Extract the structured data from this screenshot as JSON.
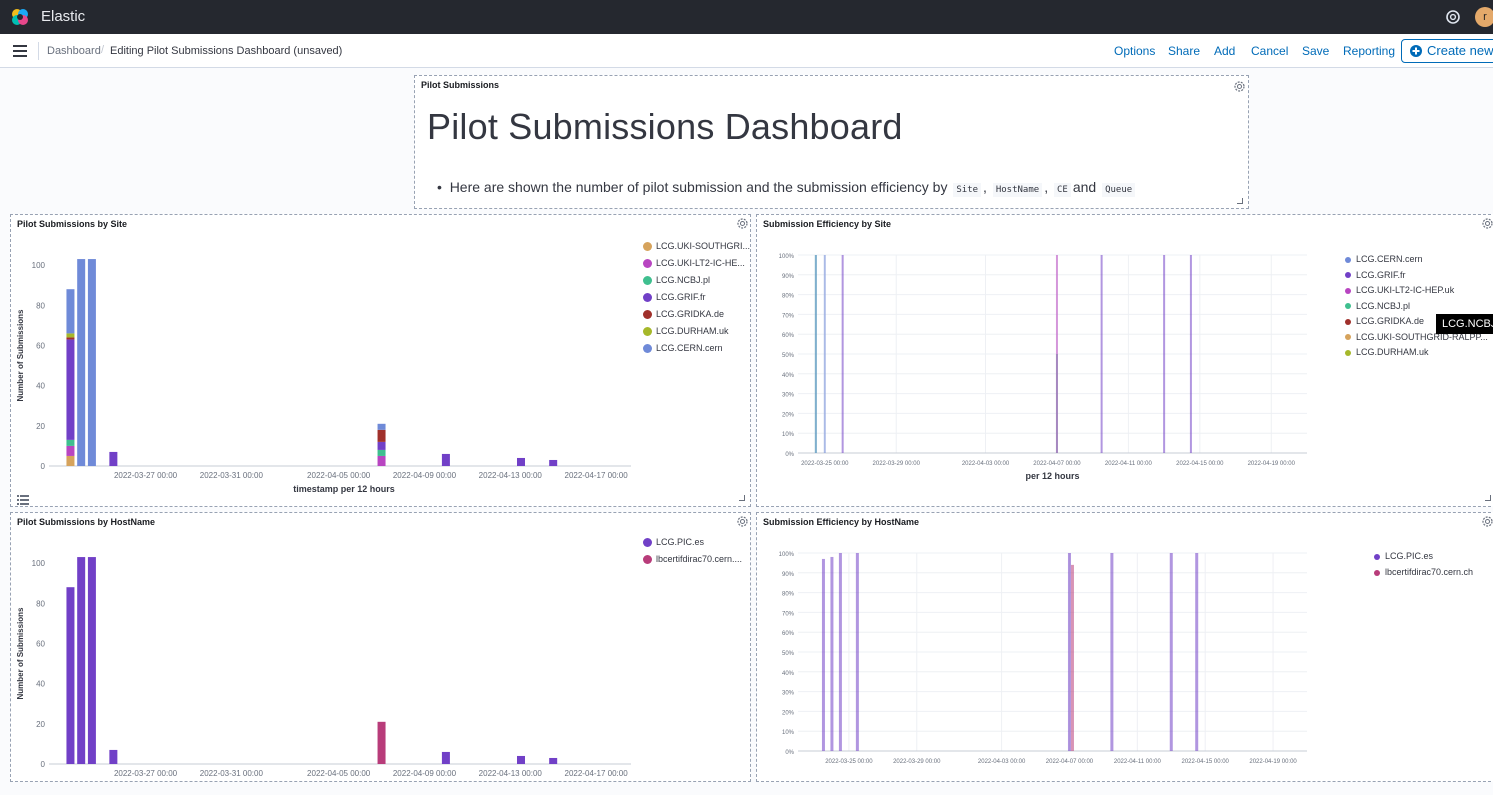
{
  "app": {
    "title": "Elastic",
    "avatar_initial": "r"
  },
  "breadcrumb": {
    "root": "Dashboard",
    "separator": "/",
    "current": "Editing Pilot Submissions Dashboard (unsaved)"
  },
  "top_nav": {
    "links": [
      "Options",
      "Share",
      "Add",
      "Cancel",
      "Save",
      "Reporting"
    ],
    "create_new_label": "Create new"
  },
  "markdown_panel": {
    "title": "Pilot Submissions",
    "heading": "Pilot Submissions Dashboard",
    "bullet_text": "Here are shown the number of pilot submission and the submission efficiency by",
    "codes": [
      "Site",
      "HostName",
      "CE",
      "Queue"
    ],
    "separators": [
      ",",
      ",",
      "and"
    ]
  },
  "panels": {
    "site_bar": {
      "title": "Pilot Submissions by Site",
      "legend": [
        {
          "label": "LCG.UKI-SOUTHGRI...",
          "color": "#d6a35c"
        },
        {
          "label": "LCG.UKI-LT2-IC-HE...",
          "color": "#b845c1"
        },
        {
          "label": "LCG.NCBJ.pl",
          "color": "#3fbf8f"
        },
        {
          "label": "LCG.GRIF.fr",
          "color": "#7140c7"
        },
        {
          "label": "LCG.GRIDKA.de",
          "color": "#a0302b"
        },
        {
          "label": "LCG.DURHAM.uk",
          "color": "#a6b82a"
        },
        {
          "label": "LCG.CERN.cern",
          "color": "#6f8ad8"
        }
      ]
    },
    "site_eff": {
      "title": "Submission Efficiency by Site",
      "legend": [
        {
          "label": "LCG.CERN.cern",
          "color": "#6f8ad8"
        },
        {
          "label": "LCG.GRIF.fr",
          "color": "#7140c7"
        },
        {
          "label": "LCG.UKI-LT2-IC-HEP.uk",
          "color": "#b845c1"
        },
        {
          "label": "LCG.NCBJ.pl",
          "color": "#3fbf8f"
        },
        {
          "label": "LCG.GRIDKA.de",
          "color": "#a0302b"
        },
        {
          "label": "LCG.UKI-SOUTHGRID-RALPP...",
          "color": "#d6a35c"
        },
        {
          "label": "LCG.DURHAM.uk",
          "color": "#a6b82a"
        }
      ],
      "tooltip": "LCG.NCBJ.pl"
    },
    "host_bar": {
      "title": "Pilot Submissions by HostName",
      "legend": [
        {
          "label": "LCG.PIC.es",
          "color": "#7140c7"
        },
        {
          "label": "lbcertifdirac70.cern....",
          "color": "#b83c7a"
        }
      ]
    },
    "host_eff": {
      "title": "Submission Efficiency by HostName",
      "legend": [
        {
          "label": "LCG.PIC.es",
          "color": "#7140c7"
        },
        {
          "label": "lbcertifdirac70.cern.ch",
          "color": "#b83c7a"
        }
      ]
    }
  },
  "chart_data": [
    {
      "type": "bar",
      "title": "Pilot Submissions by Site",
      "xlabel": "timestamp per 12 hours",
      "ylabel": "Number of Submissions",
      "ylim": [
        0,
        110
      ],
      "yticks": [
        0,
        20,
        40,
        60,
        80,
        100
      ],
      "x_tick_labels": [
        "2022-03-27 00:00",
        "2022-03-31 00:00",
        "2022-04-05 00:00",
        "2022-04-09 00:00",
        "2022-04-13 00:00",
        "2022-04-17 00:00"
      ],
      "bars": [
        {
          "x": "2022-03-23 12:00",
          "stack": [
            {
              "series": "LCG.UKI-SOUTHGRI...",
              "value": 5
            },
            {
              "series": "LCG.UKI-LT2-IC-HE...",
              "value": 5
            },
            {
              "series": "LCG.NCBJ.pl",
              "value": 3
            },
            {
              "series": "LCG.GRIF.fr",
              "value": 50
            },
            {
              "series": "LCG.GRIDKA.de",
              "value": 1
            },
            {
              "series": "LCG.DURHAM.uk",
              "value": 2
            },
            {
              "series": "LCG.CERN.cern",
              "value": 22
            }
          ]
        },
        {
          "x": "2022-03-24 00:00",
          "stack": [
            {
              "series": "LCG.CERN.cern",
              "value": 103
            }
          ]
        },
        {
          "x": "2022-03-24 12:00",
          "stack": [
            {
              "series": "LCG.CERN.cern",
              "value": 103
            }
          ]
        },
        {
          "x": "2022-03-25 12:00",
          "stack": [
            {
              "series": "LCG.GRIF.fr",
              "value": 7
            }
          ]
        },
        {
          "x": "2022-04-07 00:00",
          "stack": [
            {
              "series": "LCG.UKI-LT2-IC-HE...",
              "value": 5
            },
            {
              "series": "LCG.NCBJ.pl",
              "value": 3
            },
            {
              "series": "LCG.GRIF.fr",
              "value": 4
            },
            {
              "series": "LCG.GRIDKA.de",
              "value": 6
            },
            {
              "series": "LCG.CERN.cern",
              "value": 3
            }
          ]
        },
        {
          "x": "2022-04-10 00:00",
          "stack": [
            {
              "series": "LCG.GRIF.fr",
              "value": 6
            }
          ]
        },
        {
          "x": "2022-04-13 12:00",
          "stack": [
            {
              "series": "LCG.GRIF.fr",
              "value": 4
            }
          ]
        },
        {
          "x": "2022-04-15 00:00",
          "stack": [
            {
              "series": "LCG.GRIF.fr",
              "value": 3
            }
          ]
        }
      ]
    },
    {
      "type": "bar",
      "title": "Submission Efficiency by Site",
      "xlabel": "per 12 hours",
      "ylabel": "",
      "ylim": [
        0,
        100
      ],
      "yticks": [
        "0%",
        "10%",
        "20%",
        "30%",
        "40%",
        "50%",
        "60%",
        "70%",
        "80%",
        "90%",
        "100%"
      ],
      "x_tick_labels": [
        "2022-03-25 00:00",
        "2022-03-29 00:00",
        "2022-04-03 00:00",
        "2022-04-07 00:00",
        "2022-04-11 00:00",
        "2022-04-15 00:00",
        "2022-04-19 00:00"
      ],
      "bars": [
        {
          "x": "2022-03-24 12:00",
          "series": "LCG.NCBJ.pl",
          "value": 100
        },
        {
          "x": "2022-03-24 12:00",
          "series": "LCG.CERN.cern",
          "value": 100
        },
        {
          "x": "2022-03-25 00:00",
          "series": "LCG.CERN.cern",
          "value": 100
        },
        {
          "x": "2022-03-26 00:00",
          "series": "LCG.GRIF.fr",
          "value": 100
        },
        {
          "x": "2022-04-07 00:00",
          "series": "LCG.NCBJ.pl",
          "value": 50
        },
        {
          "x": "2022-04-07 00:00",
          "series": "LCG.UKI-LT2-IC-HEP.uk",
          "value": 100
        },
        {
          "x": "2022-04-09 12:00",
          "series": "LCG.GRIF.fr",
          "value": 100
        },
        {
          "x": "2022-04-13 00:00",
          "series": "LCG.GRIF.fr",
          "value": 100
        },
        {
          "x": "2022-04-14 12:00",
          "series": "LCG.GRIF.fr",
          "value": 100
        }
      ]
    },
    {
      "type": "bar",
      "title": "Pilot Submissions by HostName",
      "xlabel": "",
      "ylabel": "Number of Submissions",
      "ylim": [
        0,
        110
      ],
      "yticks": [
        0,
        20,
        40,
        60,
        80,
        100
      ],
      "x_tick_labels": [
        "2022-03-27 00:00",
        "2022-03-31 00:00",
        "2022-04-05 00:00",
        "2022-04-09 00:00",
        "2022-04-13 00:00",
        "2022-04-17 00:00"
      ],
      "bars": [
        {
          "x": "2022-03-23 12:00",
          "series": "LCG.PIC.es",
          "value": 88
        },
        {
          "x": "2022-03-24 00:00",
          "series": "LCG.PIC.es",
          "value": 103
        },
        {
          "x": "2022-03-24 12:00",
          "series": "LCG.PIC.es",
          "value": 103
        },
        {
          "x": "2022-03-25 12:00",
          "series": "LCG.PIC.es",
          "value": 7
        },
        {
          "x": "2022-04-07 00:00",
          "series": "lbcertifdirac70.cern....",
          "value": 21
        },
        {
          "x": "2022-04-10 00:00",
          "series": "LCG.PIC.es",
          "value": 6
        },
        {
          "x": "2022-04-13 12:00",
          "series": "LCG.PIC.es",
          "value": 4
        },
        {
          "x": "2022-04-15 00:00",
          "series": "LCG.PIC.es",
          "value": 3
        }
      ]
    },
    {
      "type": "bar",
      "title": "Submission Efficiency by HostName",
      "xlabel": "",
      "ylabel": "",
      "ylim": [
        0,
        100
      ],
      "yticks": [
        "0%",
        "10%",
        "20%",
        "30%",
        "40%",
        "50%",
        "60%",
        "70%",
        "80%",
        "90%",
        "100%"
      ],
      "x_tick_labels": [
        "2022-03-25 00:00",
        "2022-03-29 00:00",
        "2022-04-03 00:00",
        "2022-04-07 00:00",
        "2022-04-11 00:00",
        "2022-04-15 00:00",
        "2022-04-19 00:00"
      ],
      "bars": [
        {
          "x": "2022-03-23 12:00",
          "series": "LCG.PIC.es",
          "value": 97
        },
        {
          "x": "2022-03-24 00:00",
          "series": "LCG.PIC.es",
          "value": 98
        },
        {
          "x": "2022-03-24 12:00",
          "series": "LCG.PIC.es",
          "value": 100
        },
        {
          "x": "2022-03-25 12:00",
          "series": "LCG.PIC.es",
          "value": 100
        },
        {
          "x": "2022-04-07 00:00",
          "series": "LCG.PIC.es",
          "value": 100
        },
        {
          "x": "2022-04-07 00:00",
          "series": "lbcertifdirac70.cern.ch",
          "value": 94
        },
        {
          "x": "2022-04-09 12:00",
          "series": "LCG.PIC.es",
          "value": 100
        },
        {
          "x": "2022-04-13 00:00",
          "series": "LCG.PIC.es",
          "value": 100
        },
        {
          "x": "2022-04-14 12:00",
          "series": "LCG.PIC.es",
          "value": 100
        }
      ]
    }
  ]
}
